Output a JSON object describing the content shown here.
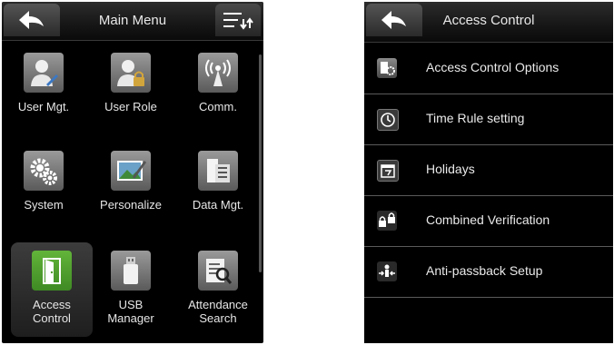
{
  "main_menu": {
    "title": "Main Menu",
    "items": [
      {
        "label": "User Mgt.",
        "icon": "user-edit-icon"
      },
      {
        "label": "User Role",
        "icon": "user-lock-icon"
      },
      {
        "label": "Comm.",
        "icon": "antenna-icon"
      },
      {
        "label": "System",
        "icon": "gears-icon"
      },
      {
        "label": "Personalize",
        "icon": "picture-edit-icon"
      },
      {
        "label": "Data Mgt.",
        "icon": "database-icon"
      },
      {
        "label": "Access\nControl",
        "icon": "door-icon",
        "selected": true
      },
      {
        "label": "USB\nManager",
        "icon": "usb-icon"
      },
      {
        "label": "Attendance\nSearch",
        "icon": "search-document-icon"
      }
    ]
  },
  "access_control": {
    "title": "Access Control",
    "items": [
      {
        "label": "Access Control Options",
        "icon": "door-settings-icon"
      },
      {
        "label": "Time Rule setting",
        "icon": "clock-icon"
      },
      {
        "label": "Holidays",
        "icon": "calendar-icon"
      },
      {
        "label": "Combined Verification",
        "icon": "lock-group-icon"
      },
      {
        "label": "Anti-passback Setup",
        "icon": "passback-icon"
      }
    ]
  },
  "colors": {
    "selected_icon": "#4f9b2b",
    "background": "#000000"
  }
}
